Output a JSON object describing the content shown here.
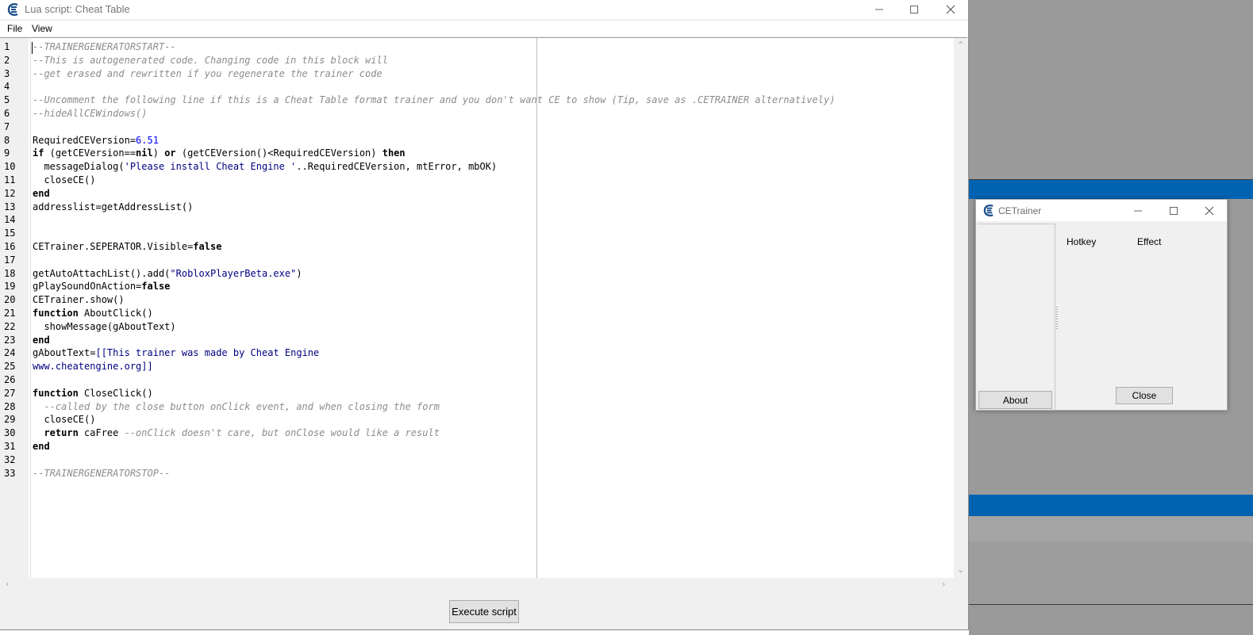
{
  "main_window": {
    "title": "Lua script: Cheat Table",
    "controls": {
      "minimize_icon": "minimize-icon",
      "maximize_icon": "maximize-icon",
      "close_icon": "close-icon"
    },
    "menu": [
      {
        "label": "File"
      },
      {
        "label": "View"
      }
    ],
    "execute_label": "Execute script"
  },
  "code_lines": [
    {
      "n": "1",
      "tokens": [
        {
          "t": "--TRAINERGENERATORSTART--",
          "c": "comment"
        }
      ]
    },
    {
      "n": "2",
      "tokens": [
        {
          "t": "--This is autogenerated code. Changing code in this block will",
          "c": "comment"
        }
      ]
    },
    {
      "n": "3",
      "tokens": [
        {
          "t": "--get erased and rewritten if you regenerate the trainer code",
          "c": "comment"
        }
      ]
    },
    {
      "n": "4",
      "tokens": []
    },
    {
      "n": "5",
      "tokens": [
        {
          "t": "--Uncomment the following line if this is a Cheat Table format trainer and you don't want CE to show (Tip, save as .CETRAINER alternatively)",
          "c": "comment"
        }
      ]
    },
    {
      "n": "6",
      "tokens": [
        {
          "t": "--hideAllCEWindows()",
          "c": "comment"
        }
      ]
    },
    {
      "n": "7",
      "tokens": []
    },
    {
      "n": "8",
      "tokens": [
        {
          "t": "RequiredCEVersion=",
          "c": ""
        },
        {
          "t": "6.51",
          "c": "num"
        }
      ]
    },
    {
      "n": "9",
      "tokens": [
        {
          "t": "if",
          "c": "kw"
        },
        {
          "t": " (getCEVersion==",
          "c": ""
        },
        {
          "t": "nil",
          "c": "kw"
        },
        {
          "t": ") ",
          "c": ""
        },
        {
          "t": "or",
          "c": "kw"
        },
        {
          "t": " (getCEVersion()<RequiredCEVersion) ",
          "c": ""
        },
        {
          "t": "then",
          "c": "kw"
        }
      ]
    },
    {
      "n": "10",
      "tokens": [
        {
          "t": "  messageDialog(",
          "c": ""
        },
        {
          "t": "'Please install Cheat Engine '",
          "c": "str"
        },
        {
          "t": "..RequiredCEVersion, mtError, mbOK)",
          "c": ""
        }
      ]
    },
    {
      "n": "11",
      "tokens": [
        {
          "t": "  closeCE()",
          "c": ""
        }
      ]
    },
    {
      "n": "12",
      "tokens": [
        {
          "t": "end",
          "c": "kw"
        }
      ]
    },
    {
      "n": "13",
      "tokens": [
        {
          "t": "addresslist=getAddressList()",
          "c": ""
        }
      ]
    },
    {
      "n": "14",
      "tokens": []
    },
    {
      "n": "15",
      "tokens": []
    },
    {
      "n": "16",
      "tokens": [
        {
          "t": "CETrainer.SEPERATOR.Visible=",
          "c": ""
        },
        {
          "t": "false",
          "c": "kw"
        }
      ]
    },
    {
      "n": "17",
      "tokens": []
    },
    {
      "n": "18",
      "tokens": [
        {
          "t": "getAutoAttachList().add(",
          "c": ""
        },
        {
          "t": "\"RobloxPlayerBeta.exe\"",
          "c": "str"
        },
        {
          "t": ")",
          "c": ""
        }
      ]
    },
    {
      "n": "19",
      "tokens": [
        {
          "t": "gPlaySoundOnAction=",
          "c": ""
        },
        {
          "t": "false",
          "c": "kw"
        }
      ]
    },
    {
      "n": "20",
      "tokens": [
        {
          "t": "CETrainer.show()",
          "c": ""
        }
      ]
    },
    {
      "n": "21",
      "tokens": [
        {
          "t": "function",
          "c": "kw"
        },
        {
          "t": " AboutClick()",
          "c": ""
        }
      ]
    },
    {
      "n": "22",
      "tokens": [
        {
          "t": "  showMessage(gAboutText)",
          "c": ""
        }
      ]
    },
    {
      "n": "23",
      "tokens": [
        {
          "t": "end",
          "c": "kw"
        }
      ]
    },
    {
      "n": "24",
      "tokens": [
        {
          "t": "gAboutText=",
          "c": ""
        },
        {
          "t": "[[This trainer was made by Cheat Engine",
          "c": "str"
        }
      ]
    },
    {
      "n": "25",
      "tokens": [
        {
          "t": "www.cheatengine.org]]",
          "c": "str"
        }
      ]
    },
    {
      "n": "26",
      "tokens": []
    },
    {
      "n": "27",
      "tokens": [
        {
          "t": "function",
          "c": "kw"
        },
        {
          "t": " CloseClick()",
          "c": ""
        }
      ]
    },
    {
      "n": "28",
      "tokens": [
        {
          "t": "  --called by the close button onClick event, and when closing the form",
          "c": "comment"
        }
      ]
    },
    {
      "n": "29",
      "tokens": [
        {
          "t": "  closeCE()",
          "c": ""
        }
      ]
    },
    {
      "n": "30",
      "tokens": [
        {
          "t": "  return",
          "c": "kw"
        },
        {
          "t": " caFree ",
          "c": ""
        },
        {
          "t": "--onClick doesn't care, but onClose would like a result",
          "c": "comment"
        }
      ]
    },
    {
      "n": "31",
      "tokens": [
        {
          "t": "end",
          "c": "kw"
        }
      ]
    },
    {
      "n": "32",
      "tokens": []
    },
    {
      "n": "33",
      "tokens": [
        {
          "t": "--TRAINERGENERATORSTOP--",
          "c": "comment"
        }
      ]
    }
  ],
  "trainer_window": {
    "title": "CETrainer",
    "columns": {
      "hotkey": "Hotkey",
      "effect": "Effect"
    },
    "about_label": "About",
    "close_label": "Close"
  },
  "colors": {
    "accent_band": "#0063b1",
    "desktop": "#9a9a9a",
    "keyword": "#000000",
    "number": "#0000ff",
    "string": "#000080",
    "comment": "#8c8c8c"
  }
}
